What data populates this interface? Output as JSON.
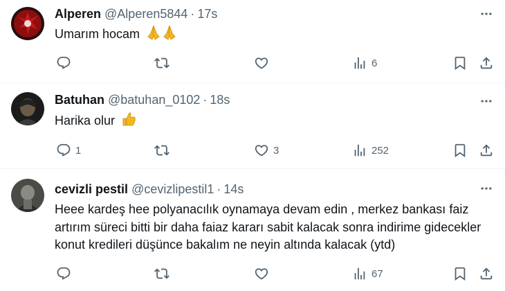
{
  "tweets": [
    {
      "name": "Alperen",
      "handle": "@Alperen5844",
      "separator": "·",
      "time": "17s",
      "text": "Umarım hocam",
      "emoji": "pray-pray",
      "stats": {
        "replies": "",
        "retweets": "",
        "likes": "",
        "views": "6"
      }
    },
    {
      "name": "Batuhan",
      "handle": "@batuhan_0102",
      "separator": "·",
      "time": "18s",
      "text": "Harika olur",
      "emoji": "thumbs-up",
      "stats": {
        "replies": "1",
        "retweets": "",
        "likes": "3",
        "views": "252"
      }
    },
    {
      "name": "cevizli pestil",
      "handle": "@cevizlipestil1",
      "separator": "·",
      "time": "14s",
      "text": "Heee kardeş hee polyanacılık oynamaya devam edin , merkez bankası faiz artırım süreci bitti bir daha faiaz kararı sabit kalacak sonra indirime gidecekler konut kredileri düşünce bakalım ne neyin altında kalacak (ytd)",
      "emoji": "",
      "stats": {
        "replies": "",
        "retweets": "",
        "likes": "",
        "views": "67"
      }
    }
  ],
  "colors": {
    "text": "#0f1419",
    "secondary": "#536471",
    "divider": "#eff3f4"
  },
  "icons": [
    "reply-icon",
    "retweet-icon",
    "like-icon",
    "views-icon",
    "bookmark-icon",
    "share-icon",
    "more-icon"
  ]
}
